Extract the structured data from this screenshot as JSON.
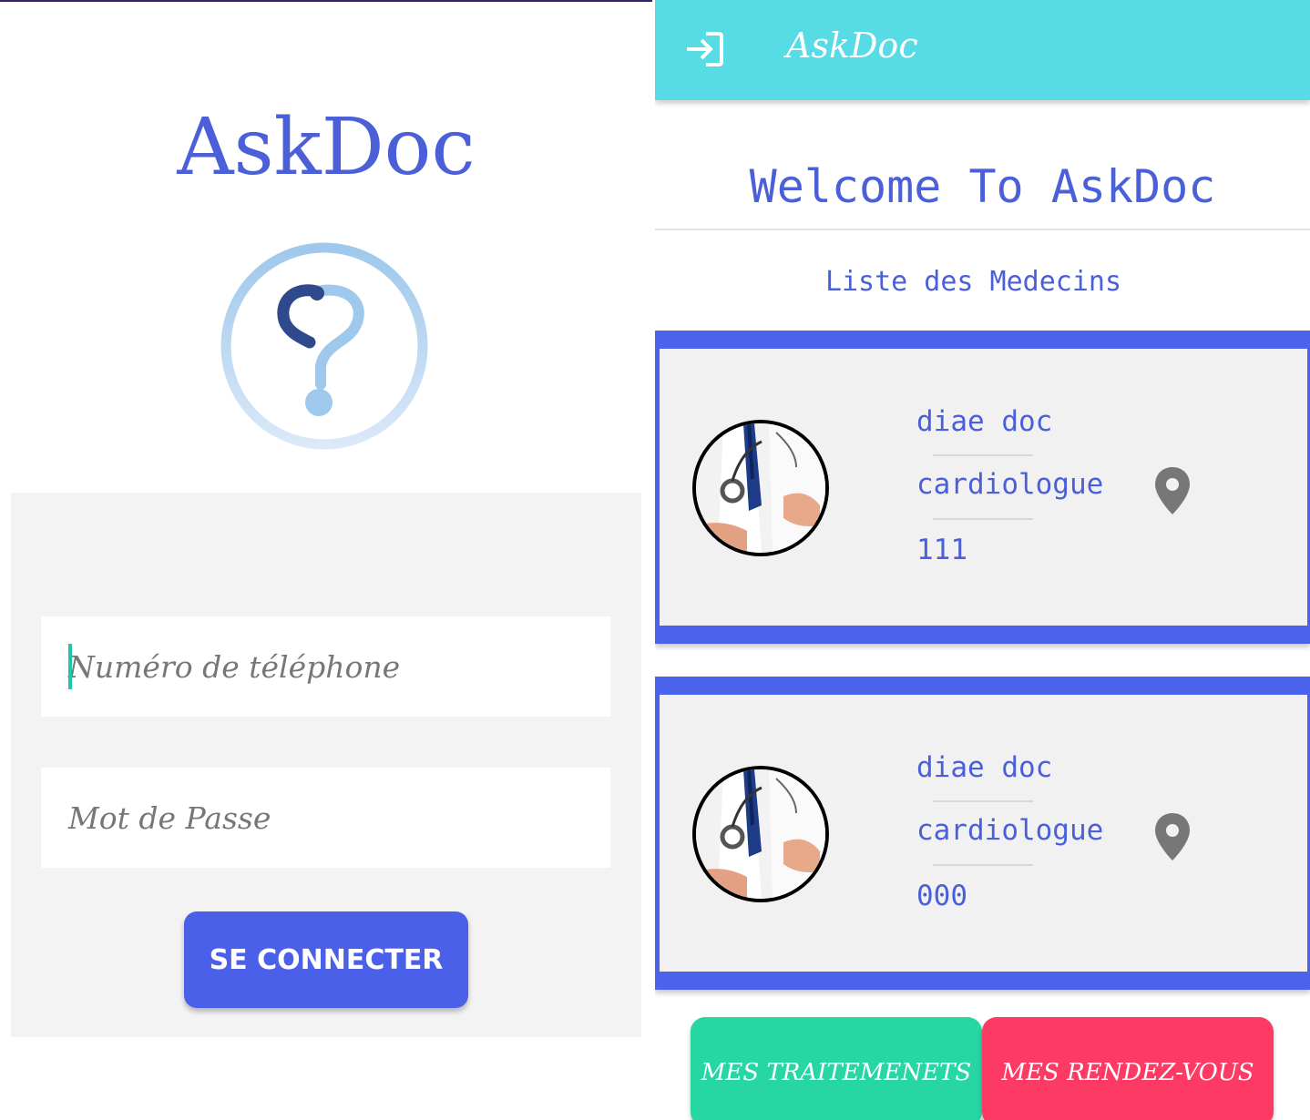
{
  "login": {
    "app_name": "AskDoc",
    "phone_placeholder": "Numéro de téléphone",
    "password_placeholder": "Mot de Passe",
    "submit_label": "SE CONNECTER"
  },
  "home": {
    "toolbar_title": "AskDoc",
    "welcome": "Welcome To AskDoc",
    "list_title": "Liste des Medecins",
    "doctors": [
      {
        "name": "diae doc",
        "specialty": "cardiologue",
        "phone": "111"
      },
      {
        "name": "diae doc",
        "specialty": "cardiologue",
        "phone": "000"
      }
    ],
    "treatments_label": "MES TRAITEMENETS",
    "appointments_label": "MES RENDEZ-VOUS"
  },
  "colors": {
    "brand_blue": "#4a5fd8",
    "appbar_cyan": "#57dbe5",
    "card_border_blue": "#4a62ec",
    "treatments_green": "#26d6a3",
    "appointments_red": "#fd3a63"
  },
  "icons": {
    "toolbar_exit": "exit-icon",
    "doctor_location": "location-pin-icon"
  }
}
